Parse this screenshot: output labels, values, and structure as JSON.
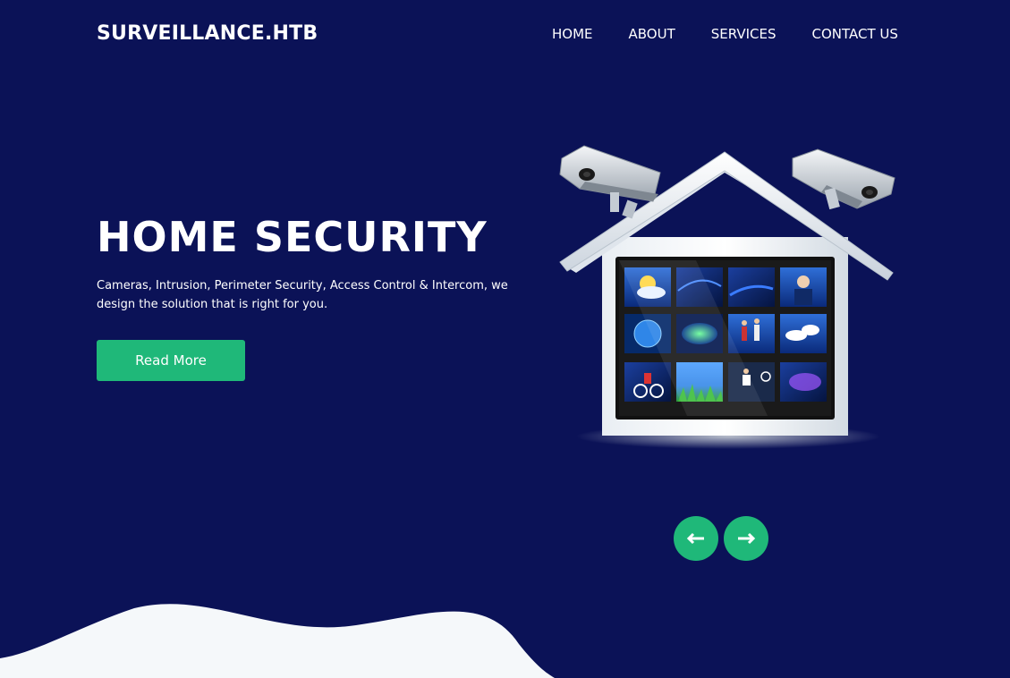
{
  "header": {
    "brand": "SURVEILLANCE.HTB",
    "nav": [
      "HOME",
      "ABOUT",
      "SERVICES",
      "CONTACT US"
    ]
  },
  "hero": {
    "title": "HOME SECURITY",
    "description": "Cameras, Intrusion, Perimeter Security, Access Control & Intercom, we design the solution that is right for you.",
    "button_label": "Read More"
  },
  "carousel": {
    "prev_icon": "arrow-left-icon",
    "next_icon": "arrow-right-icon"
  },
  "illustration": {
    "icon": "house-with-cctv-cameras-and-monitors"
  },
  "colors": {
    "background": "#0b1257",
    "accent": "#1fb879",
    "text": "#ffffff",
    "wave": "#f5f8fa"
  }
}
